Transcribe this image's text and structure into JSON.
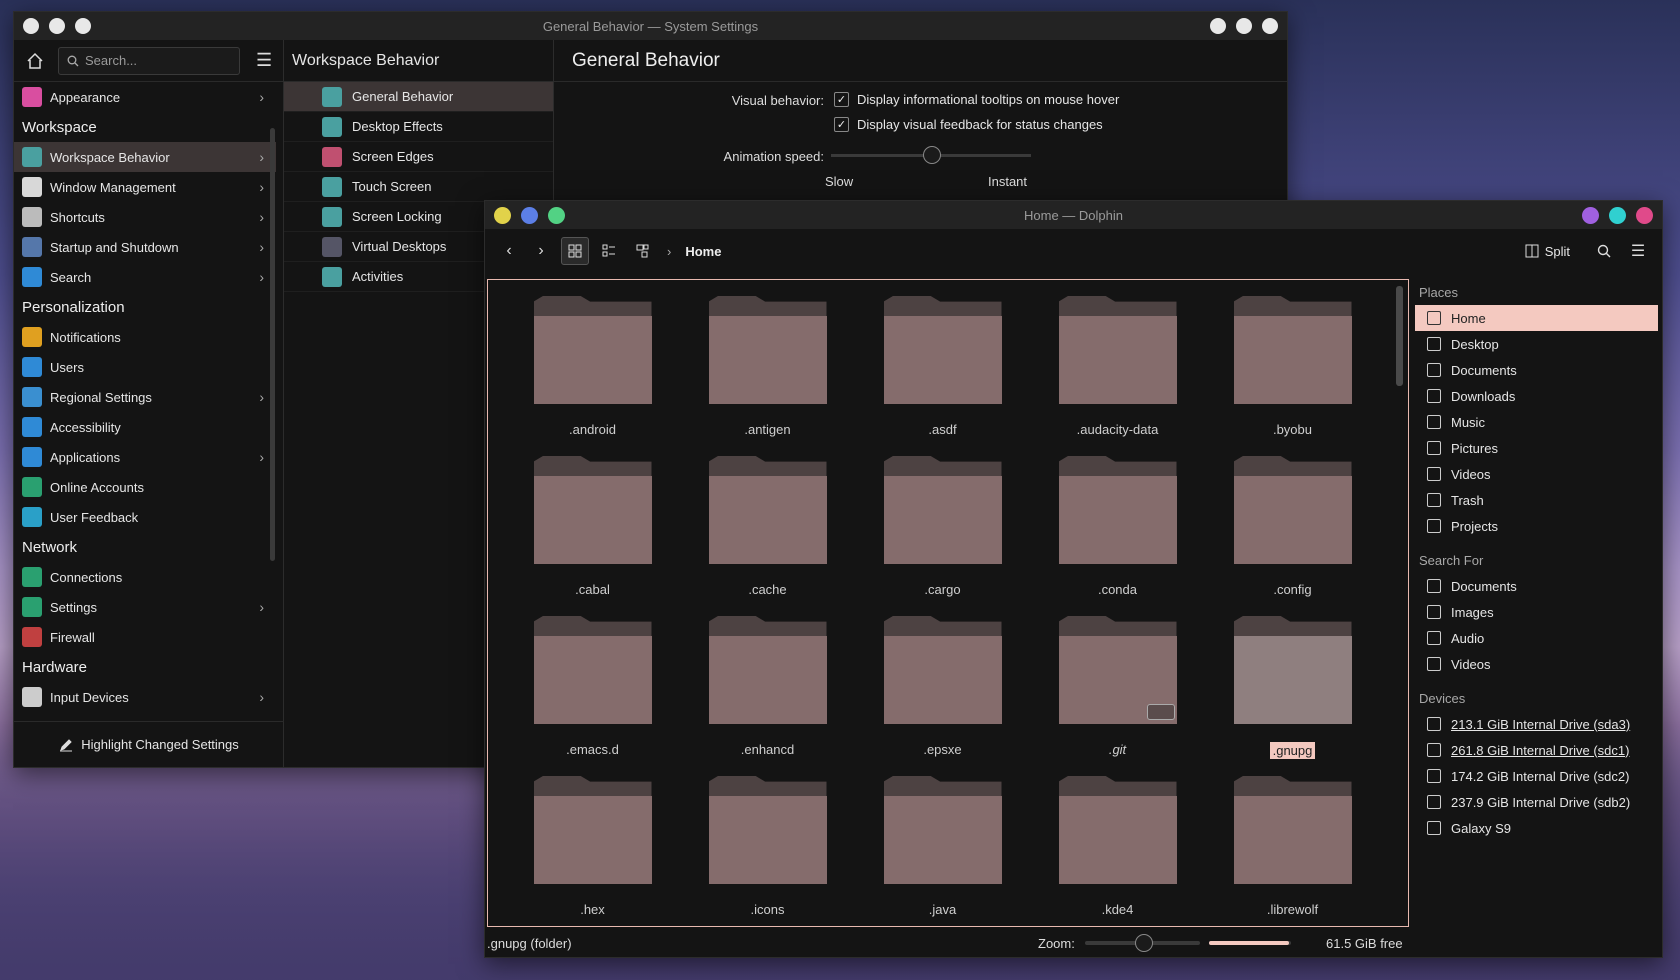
{
  "settings": {
    "title": "General Behavior — System Settings",
    "search_placeholder": "Search...",
    "categories": [
      {
        "label": "Appearance",
        "type": "item",
        "arrow": true,
        "icon": "appearance-icon",
        "color": "#d94ea0"
      },
      {
        "label": "Workspace",
        "type": "section"
      },
      {
        "label": "Workspace Behavior",
        "type": "item",
        "arrow": true,
        "selected": true,
        "icon": "workspace-icon",
        "color": "#4aa0a0"
      },
      {
        "label": "Window Management",
        "type": "item",
        "arrow": true,
        "icon": "window-icon",
        "color": "#d8d8d8"
      },
      {
        "label": "Shortcuts",
        "type": "item",
        "arrow": true,
        "icon": "keyboard-icon",
        "color": "#bbbbbb"
      },
      {
        "label": "Startup and Shutdown",
        "type": "item",
        "arrow": true,
        "icon": "power-icon",
        "color": "#5577aa"
      },
      {
        "label": "Search",
        "type": "item",
        "arrow": true,
        "icon": "search-icon",
        "color": "#2f8ad6"
      },
      {
        "label": "Personalization",
        "type": "section"
      },
      {
        "label": "Notifications",
        "type": "item",
        "icon": "bell-icon",
        "color": "#e0a020"
      },
      {
        "label": "Users",
        "type": "item",
        "icon": "users-icon",
        "color": "#2f8ad6"
      },
      {
        "label": "Regional Settings",
        "type": "item",
        "arrow": true,
        "icon": "flag-icon",
        "color": "#3a8fd0"
      },
      {
        "label": "Accessibility",
        "type": "item",
        "icon": "accessibility-icon",
        "color": "#2f8ad6"
      },
      {
        "label": "Applications",
        "type": "item",
        "arrow": true,
        "icon": "apps-icon",
        "color": "#2f8ad6"
      },
      {
        "label": "Online Accounts",
        "type": "item",
        "icon": "globe-icon",
        "color": "#2aa070"
      },
      {
        "label": "User Feedback",
        "type": "item",
        "icon": "chat-icon",
        "color": "#2aa0c8"
      },
      {
        "label": "Network",
        "type": "section"
      },
      {
        "label": "Connections",
        "type": "item",
        "icon": "globe-icon",
        "color": "#2aa070"
      },
      {
        "label": "Settings",
        "type": "item",
        "arrow": true,
        "icon": "globe-icon",
        "color": "#2aa070"
      },
      {
        "label": "Firewall",
        "type": "item",
        "icon": "firewall-icon",
        "color": "#c04040"
      },
      {
        "label": "Hardware",
        "type": "section"
      },
      {
        "label": "Input Devices",
        "type": "item",
        "arrow": true,
        "icon": "mouse-icon",
        "color": "#cccccc"
      }
    ],
    "highlight_label": "Highlight Changed Settings",
    "mid_title": "Workspace Behavior",
    "subitems": [
      {
        "label": "General Behavior",
        "selected": true,
        "icon": "general-icon",
        "color": "#4aa0a0"
      },
      {
        "label": "Desktop Effects",
        "icon": "effects-icon",
        "color": "#4aa0a0"
      },
      {
        "label": "Screen Edges",
        "icon": "edges-icon",
        "color": "#c05070"
      },
      {
        "label": "Touch Screen",
        "icon": "touch-icon",
        "color": "#4aa0a0"
      },
      {
        "label": "Screen Locking",
        "icon": "lock-icon",
        "color": "#4aa0a0"
      },
      {
        "label": "Virtual Desktops",
        "icon": "desktops-icon",
        "color": "#556"
      },
      {
        "label": "Activities",
        "icon": "activities-icon",
        "color": "#4aa0a0"
      }
    ],
    "page_title": "General Behavior",
    "visual_label": "Visual behavior:",
    "tooltip_check": "Display informational tooltips on mouse hover",
    "feedback_check": "Display visual feedback for status changes",
    "anim_label": "Animation speed:",
    "slow": "Slow",
    "instant": "Instant"
  },
  "dolphin": {
    "title": "Home — Dolphin",
    "breadcrumb": "Home",
    "split": "Split",
    "folders": [
      ".android",
      ".antigen",
      ".asdf",
      ".audacity-data",
      ".byobu",
      ".cabal",
      ".cache",
      ".cargo",
      ".conda",
      ".config",
      ".emacs.d",
      ".enhancd",
      ".epsxe",
      ".git",
      ".gnupg",
      ".hex",
      ".icons",
      ".java",
      ".kde4",
      ".librewolf"
    ],
    "selected_folder": ".gnupg",
    "places_header": "Places",
    "places": [
      "Home",
      "Desktop",
      "Documents",
      "Downloads",
      "Music",
      "Pictures",
      "Videos",
      "Trash",
      "Projects"
    ],
    "search_header": "Search For",
    "search_items": [
      "Documents",
      "Images",
      "Audio",
      "Videos"
    ],
    "devices_header": "Devices",
    "devices": [
      "213.1 GiB Internal Drive (sda3)",
      "261.8 GiB Internal Drive (sdc1)",
      "174.2 GiB Internal Drive (sdc2)",
      "237.9 GiB Internal Drive (sdb2)",
      "Galaxy S9"
    ],
    "status_text": ".gnupg (folder)",
    "zoom_label": "Zoom:",
    "free_space": "61.5 GiB free"
  }
}
